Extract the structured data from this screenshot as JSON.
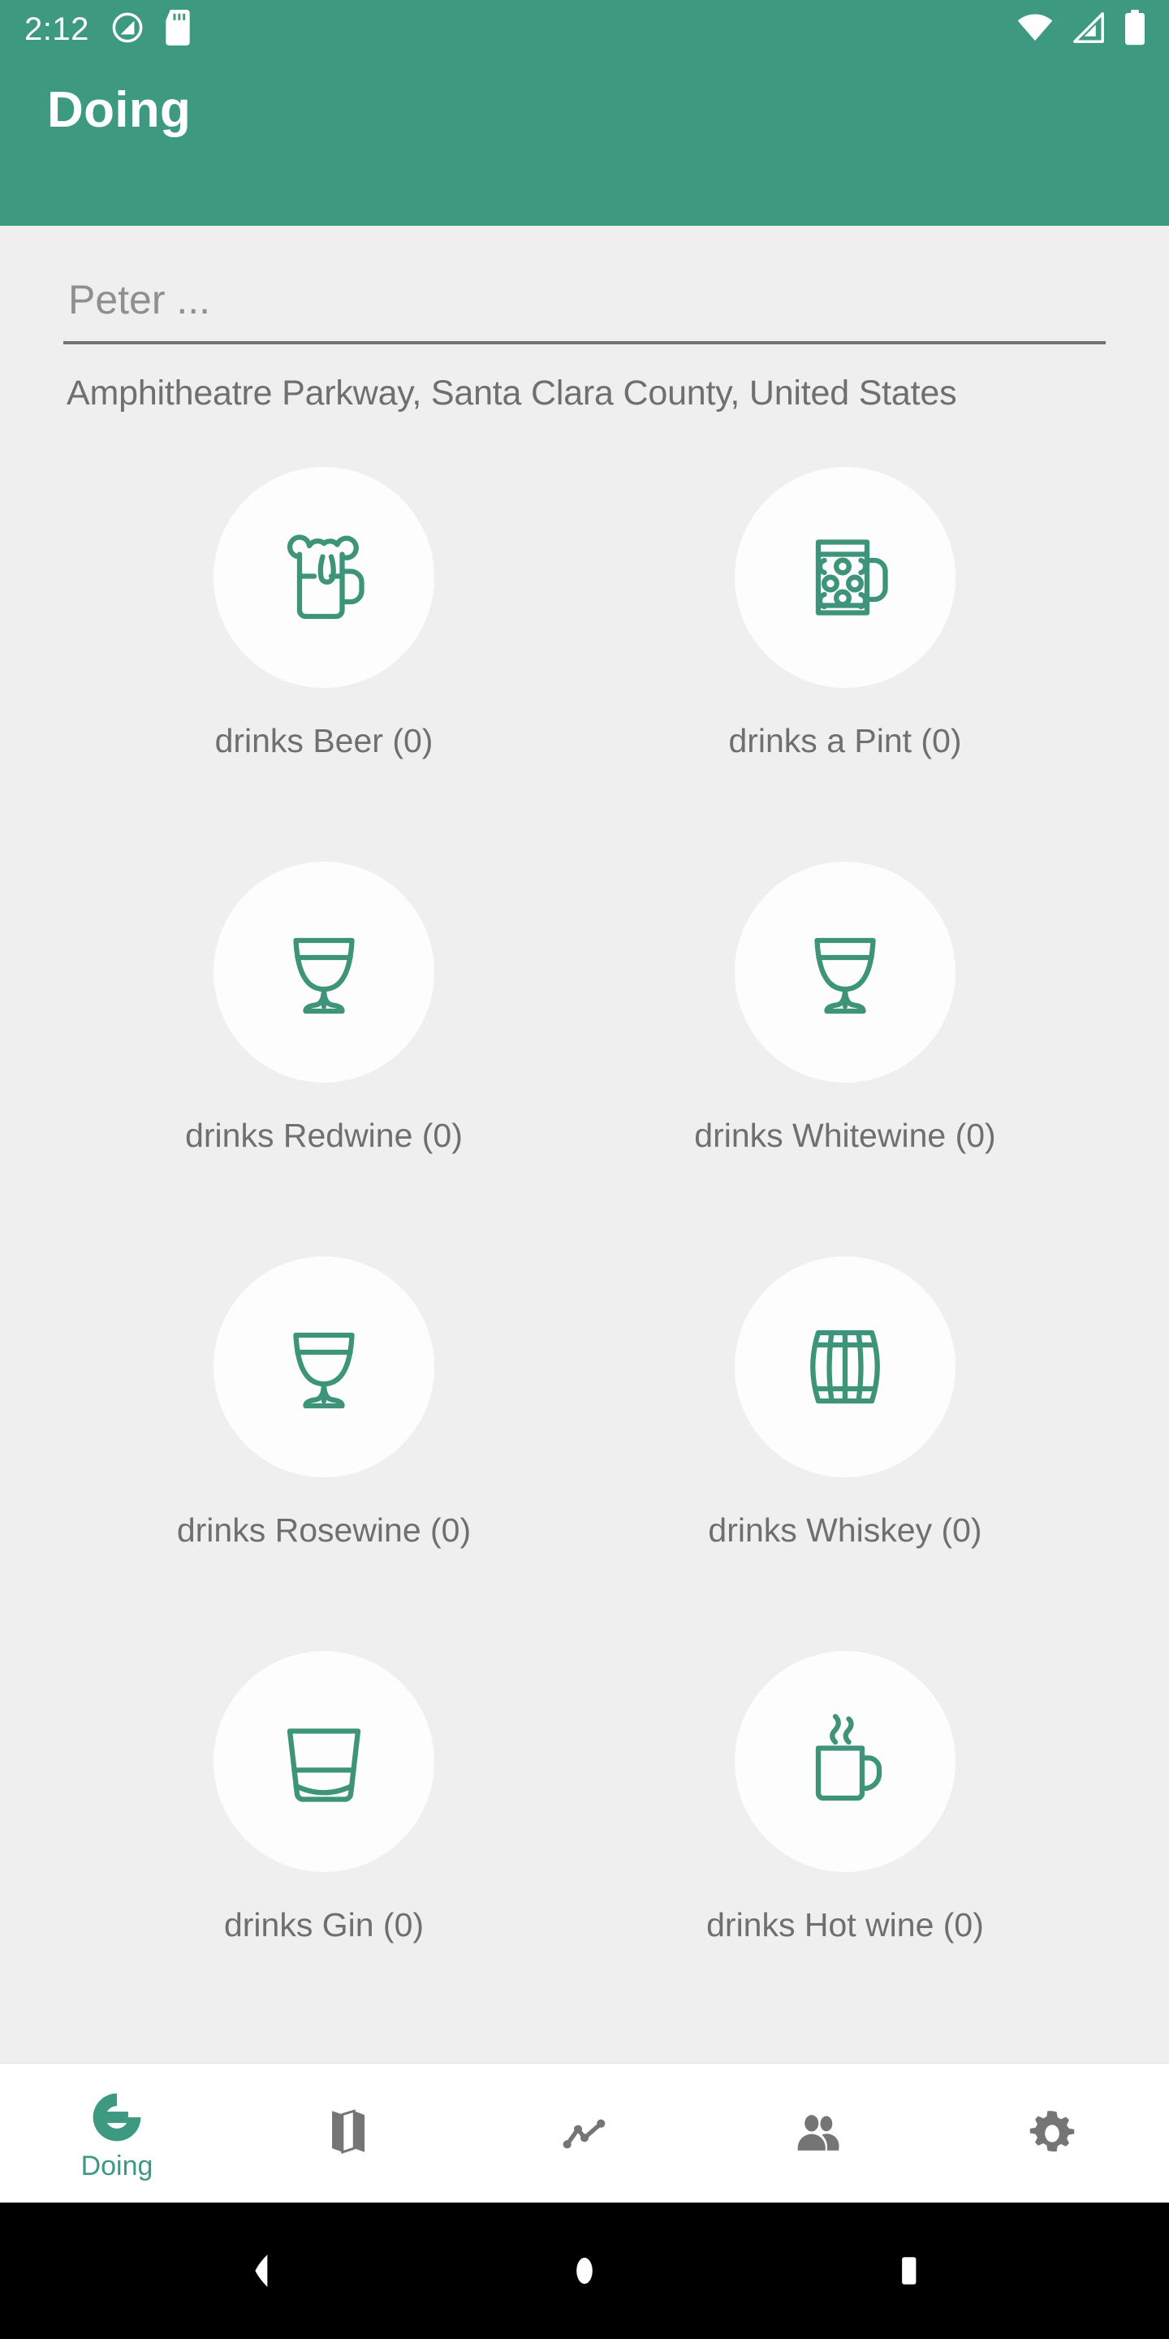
{
  "status_bar": {
    "time": "2:12",
    "left_icons": [
      "do-not-disturb-icon",
      "sd-card-icon"
    ],
    "right_icons": [
      "wifi-icon",
      "cellular-signal-icon",
      "battery-icon"
    ],
    "background_color": "#3d9a80",
    "foreground_color": "#ffffff"
  },
  "app_bar": {
    "title": "Doing",
    "background_color": "#3d9a80",
    "title_color": "#ffffff"
  },
  "form": {
    "name_input_value": "",
    "name_input_placeholder": "Peter ...",
    "address": "Amphitheatre Parkway, Santa Clara County, United States"
  },
  "theme": {
    "accent": "#3d9a80",
    "icon_stroke": "#3d9478",
    "page_background": "#efefef",
    "circle_background": "#fdfdfd",
    "label_text": "#6f6f6f",
    "inactive_nav": "#757575"
  },
  "drinks": [
    {
      "label": "drinks Beer (0)",
      "icon": "beer-mug-foam-icon",
      "count": 0
    },
    {
      "label": "drinks a Pint (0)",
      "icon": "dimpled-pint-mug-icon",
      "count": 0
    },
    {
      "label": "drinks Redwine (0)",
      "icon": "wine-glass-icon",
      "count": 0
    },
    {
      "label": "drinks Whitewine (0)",
      "icon": "wine-glass-icon",
      "count": 0
    },
    {
      "label": "drinks Rosewine (0)",
      "icon": "wine-glass-icon",
      "count": 0
    },
    {
      "label": "drinks Whiskey (0)",
      "icon": "barrel-icon",
      "count": 0
    },
    {
      "label": "drinks Gin (0)",
      "icon": "tumbler-glass-icon",
      "count": 0
    },
    {
      "label": "drinks Hot wine (0)",
      "icon": "steaming-mug-icon",
      "count": 0
    }
  ],
  "bottom_nav": {
    "items": [
      {
        "label": "Doing",
        "icon": "doing-logo-icon",
        "active": true
      },
      {
        "label": "",
        "icon": "map-icon",
        "active": false
      },
      {
        "label": "",
        "icon": "timeline-chart-icon",
        "active": false
      },
      {
        "label": "",
        "icon": "people-icon",
        "active": false
      },
      {
        "label": "",
        "icon": "gear-icon",
        "active": false
      }
    ]
  },
  "system_nav": {
    "back": "back-triangle-icon",
    "home": "home-circle-icon",
    "recents": "recents-square-icon"
  }
}
